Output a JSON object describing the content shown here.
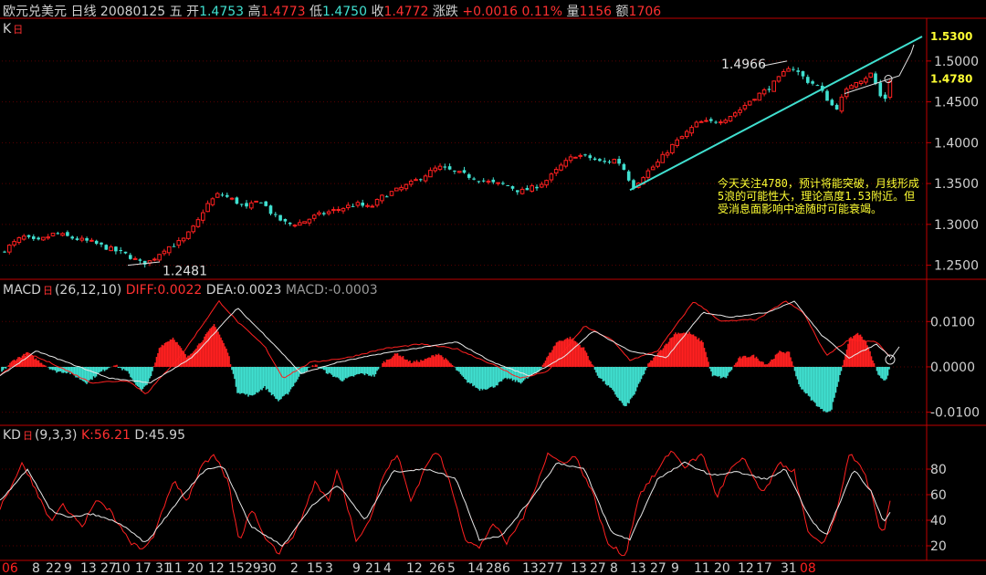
{
  "header": {
    "name": "欧元兑美元",
    "period": "日线",
    "date": "20080125",
    "weekday": "五",
    "open_label": "开",
    "open": "1.4753",
    "high_label": "高",
    "high": "1.4773",
    "low_label": "低",
    "low": "1.4750",
    "close_label": "收",
    "close": "1.4772",
    "change_label": "涨跌",
    "change": "+0.0016",
    "change_pct": "0.11%",
    "volume_label": "量",
    "volume": "1156",
    "amount_label": "额",
    "amount": "1706"
  },
  "panes": {
    "k": {
      "label": "K",
      "box": "日"
    },
    "macd": {
      "label": "MACD",
      "box": "日",
      "params": "(26,12,10)",
      "diff": "DIFF:0.0022",
      "dea": "DEA:0.0023",
      "macd": "MACD:-0.0003"
    },
    "kd": {
      "label": "KD",
      "box": "日",
      "params": "(9,3,3)",
      "k": "K:56.21",
      "d": "D:45.95"
    }
  },
  "colors": {
    "up": "#ff2020",
    "down": "#40e0d0",
    "text": "#d0d0d0",
    "axis": "#c00000",
    "note": "#ffff33",
    "trendline": "#40e0d0"
  },
  "annotations": {
    "low_label": "1.2481",
    "high_label": "1.4966",
    "target_label": "1.5300",
    "level_label": "1.4780",
    "note": "今天关注4780，预计将能突破，月线形成5浪的可能性大，理论高度1.53附近。但受消息面影响中途随时可能衰竭。"
  },
  "chart_data": [
    {
      "type": "candlestick",
      "ylim": [
        1.235,
        1.53
      ],
      "yticks": [
        "1.5000",
        "1.4500",
        "1.4000",
        "1.3500",
        "1.3000",
        "1.2500"
      ],
      "xticks": [
        "06",
        "8",
        "22",
        "9",
        "13",
        "27",
        "10",
        "17",
        "31",
        "11",
        "20",
        "12",
        "15",
        "29",
        "30",
        "2",
        "15",
        "3",
        "9",
        "21",
        "4",
        "12",
        "26",
        "5",
        "14",
        "28",
        "6",
        "13",
        "27",
        "7",
        "13",
        "27",
        "8",
        "13",
        "27",
        "9",
        "11",
        "20",
        "12",
        "17",
        "31",
        "08"
      ],
      "close_path": [
        [
          0,
          1.265
        ],
        [
          25,
          1.285
        ],
        [
          40,
          1.278
        ],
        [
          60,
          1.289
        ],
        [
          80,
          1.283
        ],
        [
          100,
          1.278
        ],
        [
          120,
          1.27
        ],
        [
          140,
          1.262
        ],
        [
          155,
          1.252
        ],
        [
          165,
          1.255
        ],
        [
          180,
          1.27
        ],
        [
          200,
          1.28
        ],
        [
          215,
          1.3
        ],
        [
          225,
          1.322
        ],
        [
          240,
          1.338
        ],
        [
          255,
          1.33
        ],
        [
          270,
          1.32
        ],
        [
          285,
          1.33
        ],
        [
          300,
          1.31
        ],
        [
          315,
          1.3
        ],
        [
          330,
          1.302
        ],
        [
          345,
          1.31
        ],
        [
          360,
          1.315
        ],
        [
          375,
          1.32
        ],
        [
          390,
          1.325
        ],
        [
          405,
          1.32
        ],
        [
          420,
          1.335
        ],
        [
          435,
          1.342
        ],
        [
          450,
          1.35
        ],
        [
          465,
          1.36
        ],
        [
          480,
          1.37
        ],
        [
          495,
          1.365
        ],
        [
          510,
          1.36
        ],
        [
          525,
          1.355
        ],
        [
          540,
          1.35
        ],
        [
          555,
          1.348
        ],
        [
          570,
          1.34
        ],
        [
          585,
          1.345
        ],
        [
          600,
          1.355
        ],
        [
          615,
          1.372
        ],
        [
          630,
          1.385
        ],
        [
          645,
          1.382
        ],
        [
          660,
          1.375
        ],
        [
          675,
          1.38
        ],
        [
          685,
          1.365
        ],
        [
          693,
          1.345
        ],
        [
          705,
          1.36
        ],
        [
          720,
          1.375
        ],
        [
          735,
          1.395
        ],
        [
          750,
          1.41
        ],
        [
          765,
          1.425
        ],
        [
          780,
          1.425
        ],
        [
          795,
          1.43
        ],
        [
          810,
          1.44
        ],
        [
          825,
          1.455
        ],
        [
          840,
          1.465
        ],
        [
          855,
          1.48
        ],
        [
          865,
          1.495
        ],
        [
          875,
          1.485
        ],
        [
          885,
          1.475
        ],
        [
          895,
          1.47
        ],
        [
          905,
          1.455
        ],
        [
          915,
          1.44
        ],
        [
          925,
          1.46
        ],
        [
          935,
          1.475
        ],
        [
          945,
          1.478
        ],
        [
          955,
          1.485
        ],
        [
          962,
          1.462
        ],
        [
          968,
          1.448
        ],
        [
          975,
          1.477
        ]
      ]
    },
    {
      "type": "bar",
      "name": "MACD",
      "ylim": [
        -0.0125,
        0.0155
      ],
      "yticks": [
        "0.0100",
        "0.0000",
        "-0.0100"
      ],
      "values_path": [
        [
          0,
          -0.0015
        ],
        [
          15,
          0.0015
        ],
        [
          30,
          0.003
        ],
        [
          45,
          0.001
        ],
        [
          60,
          -0.001
        ],
        [
          75,
          -0.0012
        ],
        [
          95,
          -0.0035
        ],
        [
          110,
          -0.0012
        ],
        [
          125,
          0.0005
        ],
        [
          140,
          -0.0012
        ],
        [
          155,
          -0.0055
        ],
        [
          165,
          -0.0025
        ],
        [
          175,
          0.0045
        ],
        [
          190,
          0.0065
        ],
        [
          205,
          0.002
        ],
        [
          220,
          0.0055
        ],
        [
          235,
          0.0095
        ],
        [
          250,
          0.003
        ],
        [
          260,
          -0.0055
        ],
        [
          275,
          -0.0065
        ],
        [
          290,
          -0.0045
        ],
        [
          305,
          -0.0075
        ],
        [
          315,
          -0.006
        ],
        [
          330,
          -0.0015
        ],
        [
          345,
          0.0005
        ],
        [
          360,
          -0.0015
        ],
        [
          375,
          -0.003
        ],
        [
          395,
          -0.0015
        ],
        [
          410,
          -0.002
        ],
        [
          420,
          0.001
        ],
        [
          435,
          0.003
        ],
        [
          450,
          0.001
        ],
        [
          465,
          0.0015
        ],
        [
          480,
          0.003
        ],
        [
          495,
          0.0005
        ],
        [
          510,
          -0.003
        ],
        [
          525,
          -0.005
        ],
        [
          540,
          -0.0045
        ],
        [
          555,
          -0.0025
        ],
        [
          570,
          -0.0035
        ],
        [
          590,
          -0.001
        ],
        [
          610,
          0.0055
        ],
        [
          625,
          0.0065
        ],
        [
          640,
          0.004
        ],
        [
          655,
          -0.002
        ],
        [
          670,
          -0.005
        ],
        [
          685,
          -0.009
        ],
        [
          695,
          -0.006
        ],
        [
          710,
          0.0005
        ],
        [
          725,
          0.004
        ],
        [
          740,
          0.0075
        ],
        [
          755,
          0.0075
        ],
        [
          770,
          0.0055
        ],
        [
          780,
          -0.002
        ],
        [
          795,
          -0.0025
        ],
        [
          810,
          0.002
        ],
        [
          825,
          0.0025
        ],
        [
          840,
          0.0005
        ],
        [
          855,
          0.0035
        ],
        [
          865,
          0.003
        ],
        [
          875,
          -0.004
        ],
        [
          890,
          -0.0075
        ],
        [
          900,
          -0.0095
        ],
        [
          910,
          -0.01
        ],
        [
          920,
          -0.002
        ],
        [
          930,
          0.006
        ],
        [
          940,
          0.0075
        ],
        [
          950,
          0.005
        ],
        [
          962,
          -0.002
        ],
        [
          970,
          -0.003
        ],
        [
          975,
          -0.0003
        ]
      ],
      "diff_path": [
        [
          0,
          -0.002
        ],
        [
          30,
          0.003
        ],
        [
          60,
          0.0005
        ],
        [
          100,
          -0.0035
        ],
        [
          140,
          -0.003
        ],
        [
          160,
          -0.006
        ],
        [
          200,
          0.003
        ],
        [
          240,
          0.0145
        ],
        [
          260,
          0.01
        ],
        [
          290,
          0.0045
        ],
        [
          310,
          -0.0025
        ],
        [
          340,
          0.001
        ],
        [
          380,
          0.002
        ],
        [
          420,
          0.004
        ],
        [
          460,
          0.005
        ],
        [
          500,
          0.004
        ],
        [
          540,
          0.0005
        ],
        [
          570,
          -0.0025
        ],
        [
          600,
          -0.001
        ],
        [
          640,
          0.009
        ],
        [
          670,
          0.006
        ],
        [
          690,
          0.0015
        ],
        [
          720,
          0.0035
        ],
        [
          760,
          0.0145
        ],
        [
          790,
          0.01
        ],
        [
          830,
          0.0105
        ],
        [
          860,
          0.0145
        ],
        [
          880,
          0.012
        ],
        [
          905,
          0.0025
        ],
        [
          930,
          0.006
        ],
        [
          960,
          0.0055
        ],
        [
          975,
          0.0022
        ]
      ],
      "dea_path": [
        [
          0,
          -0.002
        ],
        [
          40,
          0.0035
        ],
        [
          80,
          0.0005
        ],
        [
          120,
          -0.0025
        ],
        [
          165,
          -0.0035
        ],
        [
          210,
          0.002
        ],
        [
          260,
          0.013
        ],
        [
          300,
          0.005
        ],
        [
          330,
          -0.0015
        ],
        [
          370,
          0.001
        ],
        [
          420,
          0.003
        ],
        [
          470,
          0.0045
        ],
        [
          500,
          0.0055
        ],
        [
          540,
          0.001
        ],
        [
          580,
          -0.002
        ],
        [
          620,
          0.0025
        ],
        [
          650,
          0.008
        ],
        [
          690,
          0.0035
        ],
        [
          730,
          0.002
        ],
        [
          770,
          0.012
        ],
        [
          800,
          0.011
        ],
        [
          840,
          0.012
        ],
        [
          870,
          0.0145
        ],
        [
          900,
          0.007
        ],
        [
          930,
          0.002
        ],
        [
          960,
          0.005
        ],
        [
          975,
          0.0023
        ]
      ]
    },
    {
      "type": "line",
      "name": "KD",
      "ylim": [
        10,
        100
      ],
      "yticks": [
        "80",
        "60",
        "40",
        "20"
      ],
      "k_path": [
        [
          0,
          50
        ],
        [
          25,
          85
        ],
        [
          40,
          62
        ],
        [
          55,
          40
        ],
        [
          70,
          52
        ],
        [
          90,
          35
        ],
        [
          105,
          55
        ],
        [
          120,
          48
        ],
        [
          140,
          25
        ],
        [
          155,
          16
        ],
        [
          170,
          30
        ],
        [
          190,
          72
        ],
        [
          205,
          55
        ],
        [
          220,
          82
        ],
        [
          235,
          90
        ],
        [
          250,
          70
        ],
        [
          262,
          22
        ],
        [
          275,
          50
        ],
        [
          290,
          28
        ],
        [
          305,
          14
        ],
        [
          325,
          32
        ],
        [
          345,
          70
        ],
        [
          360,
          55
        ],
        [
          370,
          80
        ],
        [
          390,
          25
        ],
        [
          405,
          40
        ],
        [
          420,
          75
        ],
        [
          435,
          92
        ],
        [
          450,
          55
        ],
        [
          470,
          88
        ],
        [
          480,
          93
        ],
        [
          495,
          65
        ],
        [
          510,
          25
        ],
        [
          525,
          18
        ],
        [
          540,
          38
        ],
        [
          555,
          22
        ],
        [
          575,
          45
        ],
        [
          600,
          92
        ],
        [
          615,
          85
        ],
        [
          630,
          90
        ],
        [
          650,
          60
        ],
        [
          665,
          22
        ],
        [
          685,
          12
        ],
        [
          700,
          60
        ],
        [
          720,
          78
        ],
        [
          735,
          95
        ],
        [
          750,
          82
        ],
        [
          770,
          92
        ],
        [
          785,
          58
        ],
        [
          800,
          80
        ],
        [
          815,
          88
        ],
        [
          835,
          60
        ],
        [
          855,
          85
        ],
        [
          870,
          78
        ],
        [
          885,
          30
        ],
        [
          900,
          20
        ],
        [
          915,
          42
        ],
        [
          930,
          92
        ],
        [
          945,
          80
        ],
        [
          955,
          60
        ],
        [
          962,
          35
        ],
        [
          968,
          28
        ],
        [
          975,
          56
        ]
      ],
      "d_path": [
        [
          0,
          55
        ],
        [
          30,
          80
        ],
        [
          55,
          48
        ],
        [
          75,
          42
        ],
        [
          100,
          45
        ],
        [
          130,
          38
        ],
        [
          160,
          22
        ],
        [
          195,
          55
        ],
        [
          225,
          80
        ],
        [
          245,
          82
        ],
        [
          275,
          35
        ],
        [
          310,
          20
        ],
        [
          340,
          50
        ],
        [
          370,
          68
        ],
        [
          400,
          40
        ],
        [
          430,
          78
        ],
        [
          470,
          80
        ],
        [
          500,
          72
        ],
        [
          525,
          25
        ],
        [
          550,
          28
        ],
        [
          580,
          55
        ],
        [
          610,
          85
        ],
        [
          640,
          80
        ],
        [
          670,
          30
        ],
        [
          690,
          25
        ],
        [
          720,
          72
        ],
        [
          750,
          85
        ],
        [
          780,
          75
        ],
        [
          805,
          78
        ],
        [
          840,
          72
        ],
        [
          860,
          80
        ],
        [
          890,
          38
        ],
        [
          905,
          28
        ],
        [
          935,
          80
        ],
        [
          955,
          62
        ],
        [
          968,
          38
        ],
        [
          975,
          46
        ]
      ]
    }
  ]
}
